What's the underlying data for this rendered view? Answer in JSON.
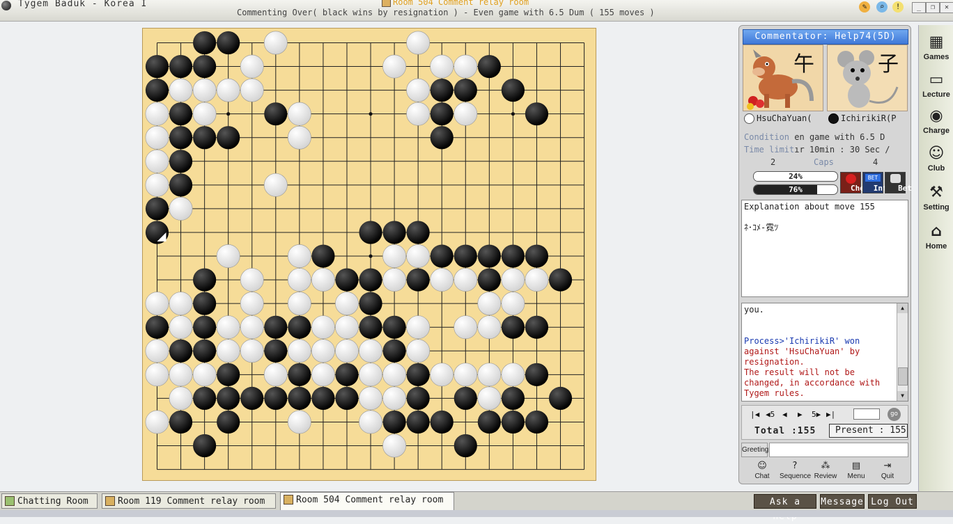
{
  "titlebar": {
    "app_title": "Tygem Baduk - Korea I",
    "room_title": "Room 504 Comment relay room",
    "status": "Commenting Over( black wins by resignation ) - Even game with 6.5 Dum  ( 155 moves )"
  },
  "board": {
    "size": 19,
    "black": [
      [
        2,
        0
      ],
      [
        3,
        0
      ],
      [
        0,
        1
      ],
      [
        1,
        1
      ],
      [
        2,
        1
      ],
      [
        14,
        1
      ],
      [
        0,
        2
      ],
      [
        12,
        2
      ],
      [
        13,
        2
      ],
      [
        15,
        2
      ],
      [
        1,
        3
      ],
      [
        5,
        3
      ],
      [
        12,
        3
      ],
      [
        16,
        3
      ],
      [
        1,
        4
      ],
      [
        2,
        4
      ],
      [
        3,
        4
      ],
      [
        12,
        4
      ],
      [
        1,
        5
      ],
      [
        1,
        6
      ],
      [
        0,
        7
      ],
      [
        0,
        8
      ],
      [
        9,
        8
      ],
      [
        10,
        8
      ],
      [
        11,
        8
      ],
      [
        7,
        9
      ],
      [
        12,
        9
      ],
      [
        13,
        9
      ],
      [
        14,
        9
      ],
      [
        15,
        9
      ],
      [
        16,
        9
      ],
      [
        2,
        10
      ],
      [
        8,
        10
      ],
      [
        9,
        10
      ],
      [
        11,
        10
      ],
      [
        14,
        10
      ],
      [
        17,
        10
      ],
      [
        2,
        11
      ],
      [
        9,
        11
      ],
      [
        0,
        12
      ],
      [
        2,
        12
      ],
      [
        5,
        12
      ],
      [
        6,
        12
      ],
      [
        9,
        12
      ],
      [
        10,
        12
      ],
      [
        15,
        12
      ],
      [
        16,
        12
      ],
      [
        1,
        13
      ],
      [
        2,
        13
      ],
      [
        5,
        13
      ],
      [
        10,
        13
      ],
      [
        3,
        14
      ],
      [
        6,
        14
      ],
      [
        8,
        14
      ],
      [
        11,
        14
      ],
      [
        16,
        14
      ],
      [
        2,
        15
      ],
      [
        3,
        15
      ],
      [
        4,
        15
      ],
      [
        5,
        15
      ],
      [
        6,
        15
      ],
      [
        7,
        15
      ],
      [
        8,
        15
      ],
      [
        11,
        15
      ],
      [
        13,
        15
      ],
      [
        15,
        15
      ],
      [
        17,
        15
      ],
      [
        1,
        16
      ],
      [
        3,
        16
      ],
      [
        10,
        16
      ],
      [
        11,
        16
      ],
      [
        12,
        16
      ],
      [
        14,
        16
      ],
      [
        15,
        16
      ],
      [
        16,
        16
      ],
      [
        2,
        17
      ],
      [
        13,
        17
      ]
    ],
    "white": [
      [
        5,
        0
      ],
      [
        11,
        0
      ],
      [
        4,
        1
      ],
      [
        10,
        1
      ],
      [
        12,
        1
      ],
      [
        13,
        1
      ],
      [
        1,
        2
      ],
      [
        2,
        2
      ],
      [
        3,
        2
      ],
      [
        4,
        2
      ],
      [
        11,
        2
      ],
      [
        0,
        3
      ],
      [
        2,
        3
      ],
      [
        6,
        3
      ],
      [
        11,
        3
      ],
      [
        13,
        3
      ],
      [
        0,
        4
      ],
      [
        6,
        4
      ],
      [
        0,
        5
      ],
      [
        0,
        6
      ],
      [
        5,
        6
      ],
      [
        1,
        7
      ],
      [
        3,
        9
      ],
      [
        6,
        9
      ],
      [
        10,
        9
      ],
      [
        11,
        9
      ],
      [
        4,
        10
      ],
      [
        6,
        10
      ],
      [
        7,
        10
      ],
      [
        10,
        10
      ],
      [
        12,
        10
      ],
      [
        13,
        10
      ],
      [
        15,
        10
      ],
      [
        16,
        10
      ],
      [
        0,
        11
      ],
      [
        1,
        11
      ],
      [
        4,
        11
      ],
      [
        6,
        11
      ],
      [
        8,
        11
      ],
      [
        14,
        11
      ],
      [
        15,
        11
      ],
      [
        1,
        12
      ],
      [
        3,
        12
      ],
      [
        4,
        12
      ],
      [
        7,
        12
      ],
      [
        8,
        12
      ],
      [
        11,
        12
      ],
      [
        13,
        12
      ],
      [
        14,
        12
      ],
      [
        0,
        13
      ],
      [
        3,
        13
      ],
      [
        4,
        13
      ],
      [
        6,
        13
      ],
      [
        7,
        13
      ],
      [
        8,
        13
      ],
      [
        9,
        13
      ],
      [
        11,
        13
      ],
      [
        0,
        14
      ],
      [
        1,
        14
      ],
      [
        2,
        14
      ],
      [
        5,
        14
      ],
      [
        7,
        14
      ],
      [
        9,
        14
      ],
      [
        10,
        14
      ],
      [
        12,
        14
      ],
      [
        13,
        14
      ],
      [
        14,
        14
      ],
      [
        15,
        14
      ],
      [
        1,
        15
      ],
      [
        9,
        15
      ],
      [
        10,
        15
      ],
      [
        14,
        15
      ],
      [
        0,
        16
      ],
      [
        6,
        16
      ],
      [
        9,
        16
      ],
      [
        10,
        17
      ]
    ],
    "last_move": [
      0,
      8
    ],
    "hoshi": [
      [
        3,
        3
      ],
      [
        9,
        3
      ],
      [
        15,
        3
      ],
      [
        3,
        9
      ],
      [
        9,
        9
      ],
      [
        15,
        9
      ],
      [
        3,
        15
      ],
      [
        9,
        15
      ],
      [
        15,
        15
      ]
    ]
  },
  "panel": {
    "commentator": "Commentator: Help74(5D)",
    "white_zodiac": "午",
    "black_zodiac": "子",
    "white_player": "HsuChaYuan(",
    "black_player": "IchirikiR(P",
    "condition_label": "Condition",
    "condition_value": "en game with 6.5 D",
    "time_label": "Time limit",
    "time_value": "ır 10min : 30 Sec /",
    "caps_white": "2",
    "caps_label": "Caps",
    "caps_black": "4",
    "white_win_pct": 24,
    "black_win_pct": 76,
    "white_win_text": "24%",
    "black_win_text": "76%",
    "btn_cheer": "Cheer",
    "btn_info_badge": "BET",
    "btn_info": "Info",
    "btn_bet": "Bet",
    "explanation_title": "Explanation about move 155",
    "explanation_body": "ﾈ･ｺﾒ-霓ﾂ",
    "chat": [
      {
        "text": "you.",
        "color": "black"
      },
      {
        "text": "",
        "color": "black"
      },
      {
        "text": "",
        "color": "black"
      },
      {
        "text": "Process>'IchirikiR' won",
        "color": "blue"
      },
      {
        "text": "against 'HsuChaYuan' by",
        "color": "red"
      },
      {
        "text": "resignation.",
        "color": "red"
      },
      {
        "text": "The result will not be",
        "color": "red"
      },
      {
        "text": "changed, in accordance with",
        "color": "red"
      },
      {
        "text": "Tygem rules.",
        "color": "red"
      }
    ],
    "nav_first": "|◀",
    "nav_back5": "◀5",
    "nav_back": "◀",
    "nav_fwd": "▶",
    "nav_fwd5": "5▶",
    "nav_last": "▶|",
    "go": "go",
    "move_input": "",
    "total": "Total :155",
    "present": "Present : 155",
    "greeting_label": "Greeting",
    "greeting_value": "",
    "buttons": [
      "Chat",
      "Sequence",
      "Review",
      "Menu",
      "Quit"
    ]
  },
  "sidebar": [
    "Games",
    "Lecture",
    "Charge",
    "Club",
    "Setting",
    "Home"
  ],
  "tabs": [
    "Chatting Room",
    "Room 119 Comment relay room",
    "Room 504 Comment relay room"
  ],
  "status_buttons": [
    "Ask a help",
    "Message",
    "Log Out"
  ],
  "colors": {
    "board": "#f6dc98",
    "accent": "#3f78d8",
    "status_btn": "#5a5246"
  }
}
